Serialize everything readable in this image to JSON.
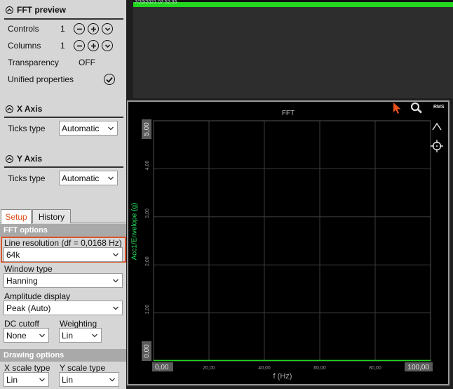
{
  "fft_preview": {
    "title": "FFT preview",
    "controls": {
      "label": "Controls",
      "value": "1"
    },
    "columns": {
      "label": "Columns",
      "value": "1"
    },
    "transparency": {
      "label": "Transparency",
      "value": "OFF"
    },
    "unified": {
      "label": "Unified properties"
    }
  },
  "x_axis": {
    "title": "X Axis",
    "ticks_label": "Ticks type",
    "ticks_value": "Automatic"
  },
  "y_axis": {
    "title": "Y Axis",
    "ticks_label": "Ticks type",
    "ticks_value": "Automatic"
  },
  "tabs": {
    "setup": "Setup",
    "history": "History"
  },
  "fft_options": {
    "header": "FFT options",
    "line_resolution_label": "Line resolution (df = 0,0168 Hz)",
    "line_resolution_value": "64k",
    "window_type_label": "Window type",
    "window_type_value": "Hanning",
    "amplitude_label": "Amplitude display",
    "amplitude_value": "Peak (Auto)",
    "dc_cutoff_label": "DC cutoff",
    "dc_cutoff_value": "None",
    "weighting_label": "Weighting",
    "weighting_value": "Lin"
  },
  "drawing_options": {
    "header": "Drawing options",
    "x_scale_label": "X scale type",
    "x_scale_value": "Lin",
    "y_scale_label": "Y scale type",
    "y_scale_value": "Lin"
  },
  "top_strip": {
    "timestamp": "7/20/2021 07:52:35"
  },
  "toolbar": {
    "rms_label": "RMS"
  },
  "icons": [
    "cursor-icon",
    "magnifier-icon",
    "peak-marker-icon",
    "crosshair-icon"
  ],
  "colors": {
    "accent": "#e0531b",
    "trace": "#23d61e",
    "ylabel": "#27e05a",
    "panel_bg": "#d6d6d6"
  },
  "chart_data": {
    "type": "line",
    "title": "FFT",
    "xlabel": "f (Hz)",
    "ylabel": "Acc1/Envelope (g)",
    "xlim": [
      0,
      100
    ],
    "ylim": [
      0,
      5
    ],
    "x_ticks": [
      "0,00",
      "20,00",
      "40,00",
      "60,00",
      "80,00",
      "100,00"
    ],
    "y_ticks": [
      "0,00",
      "1,00",
      "2,00",
      "3,00",
      "4,00",
      "5,00"
    ],
    "grid": true,
    "series": [
      {
        "x": [
          0,
          20,
          40,
          60,
          80,
          100
        ],
        "values": [
          0.01,
          0.01,
          0.01,
          0.01,
          0.01,
          0.01
        ]
      }
    ]
  }
}
